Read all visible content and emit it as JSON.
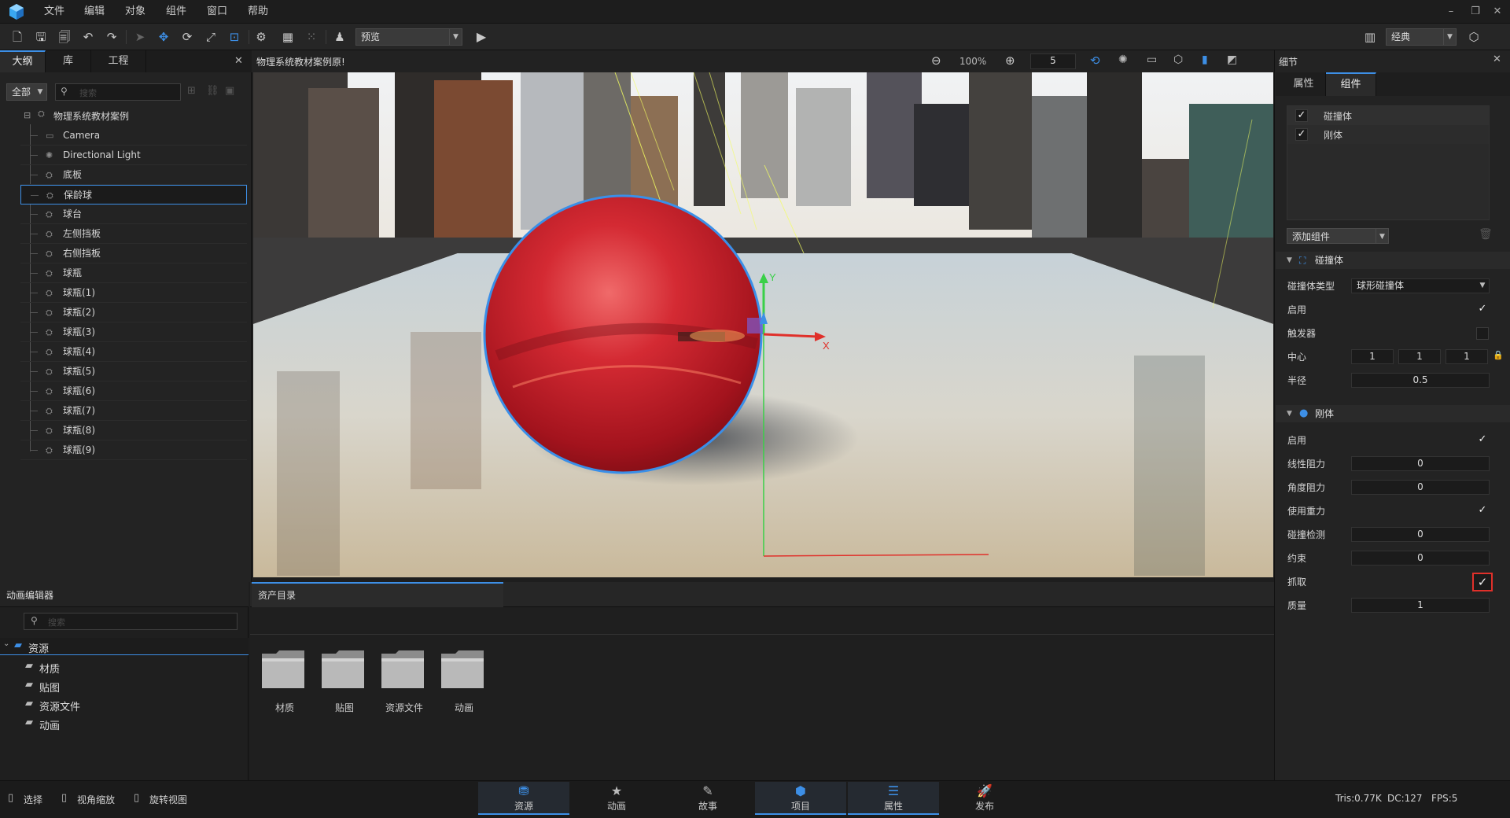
{
  "menu": [
    "文件",
    "编辑",
    "对象",
    "组件",
    "窗口",
    "帮助"
  ],
  "toolbar": {
    "preview_select": "预览",
    "layout_select": "经典"
  },
  "outline_tabs": [
    "大纲",
    "库",
    "工程"
  ],
  "outline": {
    "filter": "全部",
    "search_placeholder": "搜索",
    "root": "物理系统教材案例",
    "items": [
      "Camera",
      "Directional Light",
      "底板",
      "保龄球",
      "球台",
      "左侧挡板",
      "右侧挡板",
      "球瓶",
      "球瓶(1)",
      "球瓶(2)",
      "球瓶(3)",
      "球瓶(4)",
      "球瓶(5)",
      "球瓶(6)",
      "球瓶(7)",
      "球瓶(8)",
      "球瓶(9)"
    ],
    "selected_index": 3
  },
  "viewport": {
    "title": "物理系统教材案例原!",
    "zoom": "100%",
    "grid_size": "5",
    "axis_x": "X",
    "axis_y": "Y"
  },
  "details": {
    "title": "细节",
    "tabs": [
      "属性",
      "组件"
    ],
    "components": [
      "碰撞体",
      "刚体"
    ],
    "add_component": "添加组件",
    "collider": {
      "section": "碰撞体",
      "type_label": "碰撞体类型",
      "type_value": "球形碰撞体",
      "enable_label": "启用",
      "trigger_label": "触发器",
      "center_label": "中心",
      "center": [
        "1",
        "1",
        "1"
      ],
      "radius_label": "半径",
      "radius": "0.5"
    },
    "rigidbody": {
      "section": "刚体",
      "enable_label": "启用",
      "linear_drag_label": "线性阻力",
      "linear_drag": "0",
      "angular_drag_label": "角度阻力",
      "angular_drag": "0",
      "gravity_label": "使用重力",
      "collision_label": "碰撞检测",
      "collision": "0",
      "constraint_label": "约束",
      "constraint": "0",
      "grab_label": "抓取",
      "mass_label": "质量",
      "mass": "1"
    }
  },
  "anim_editor": {
    "title": "动画编辑器",
    "search_placeholder": "搜索",
    "root": "资源",
    "folders": [
      "材质",
      "贴图",
      "资源文件",
      "动画"
    ]
  },
  "assets": {
    "tab": "资产目录",
    "folders": [
      "材质",
      "贴图",
      "资源文件",
      "动画"
    ]
  },
  "status": {
    "hints": [
      "选择",
      "视角缩放",
      "旋转视图"
    ],
    "tris": "Tris:0.77K",
    "dc": "DC:127",
    "fps": "FPS:5"
  },
  "bottom_nav": [
    "资源",
    "动画",
    "故事",
    "项目",
    "属性",
    "发布"
  ],
  "colors": {
    "accent": "#3d8fe6",
    "highlight_red": "#e0302a",
    "ball": "#c41e2a"
  }
}
